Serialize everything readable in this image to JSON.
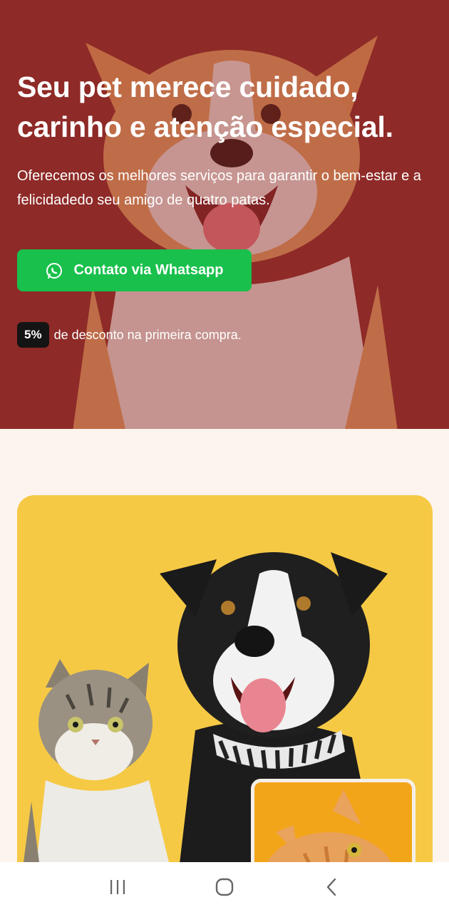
{
  "hero": {
    "title": "Seu pet merece cuidado, carinho e atenção especial.",
    "subtitle": "Oferecemos os melhores serviços para garantir o bem-estar e a felicidadedo seu amigo de quatro patas.",
    "cta_label": "Contato via Whatsapp",
    "cta_icon": "whatsapp-icon",
    "discount_badge": "5%",
    "discount_text": "de desconto na primeira compra.",
    "background_color": "#8e2a27",
    "cta_color": "#19c04c"
  },
  "showcase": {
    "background_color": "#f6c945",
    "thumbnail_color": "#f3a51a"
  },
  "navbar": {
    "items": [
      {
        "icon": "recent-apps-icon"
      },
      {
        "icon": "home-icon"
      },
      {
        "icon": "back-icon"
      }
    ]
  }
}
